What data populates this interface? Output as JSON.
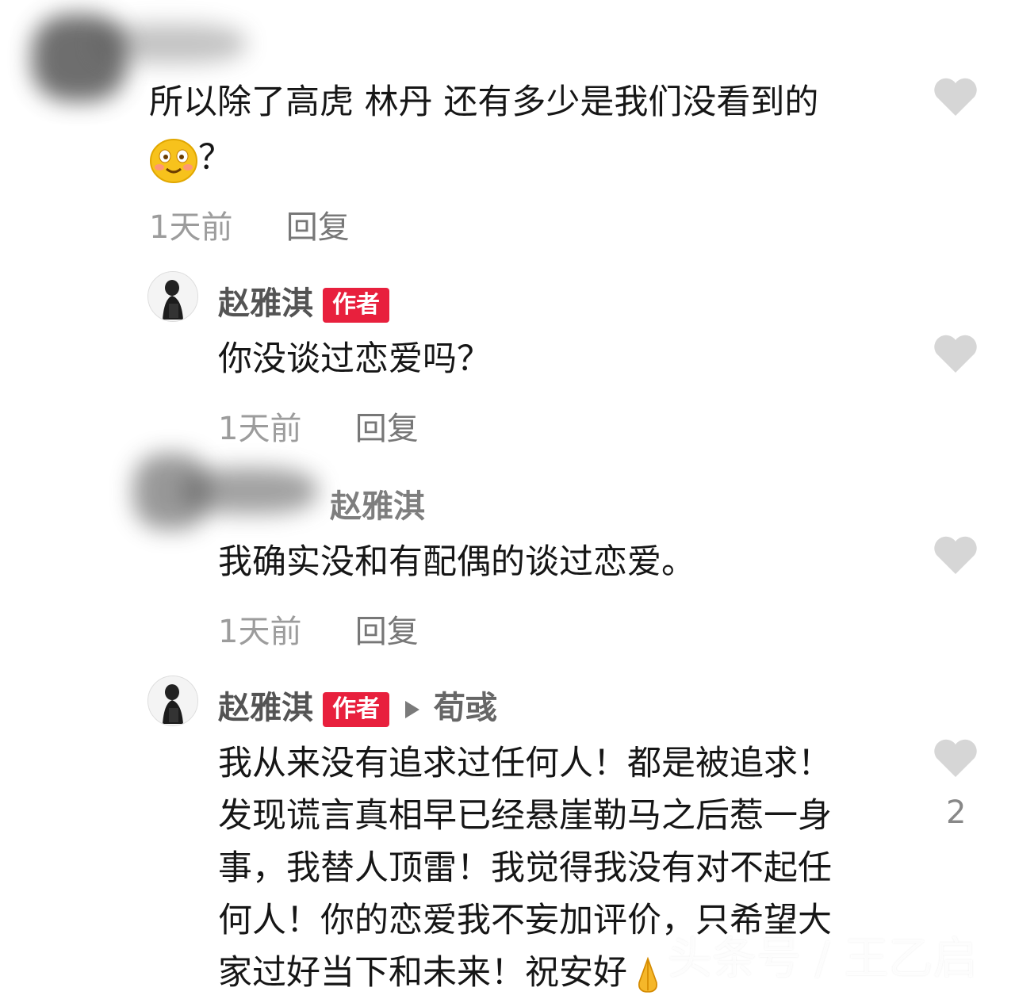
{
  "comments": [
    {
      "text_line1": "所以除了高虎 林丹 还有多少是我们没看到的",
      "text_line2": "？",
      "time": "1天前",
      "reply": "回复"
    },
    {
      "user": "赵雅淇",
      "badge": "作者",
      "text": "你没谈过恋爱吗？",
      "time": "1天前",
      "reply": "回复"
    },
    {
      "reply_to": "赵雅淇",
      "text": "我确实没和有配偶的谈过恋爱。",
      "time": "1天前",
      "reply": "回复"
    },
    {
      "user": "赵雅淇",
      "badge": "作者",
      "reply_to": "荀彧",
      "lines": [
        "我从来没有追求过任何人！都是被追求！",
        "发现谎言真相早已经悬崖勒马之后惹一身",
        "事，我替人顶雷！我觉得我没有对不起任",
        "何人！你的恋爱我不妄加评价，只希望大",
        "家过好当下和未来！祝安好"
      ],
      "like_count": "2"
    }
  ],
  "watermark": "头条号 / 王乙启",
  "icons": {
    "like": "heart-icon",
    "emoji": "smile-emoji-icon",
    "emoji2": "pray-emoji-icon",
    "reply_arrow": "triangle-right-icon"
  },
  "colors": {
    "author_badge": "#e8203d",
    "heart": "#d6d6d6",
    "meta": "#9c9c9c"
  }
}
